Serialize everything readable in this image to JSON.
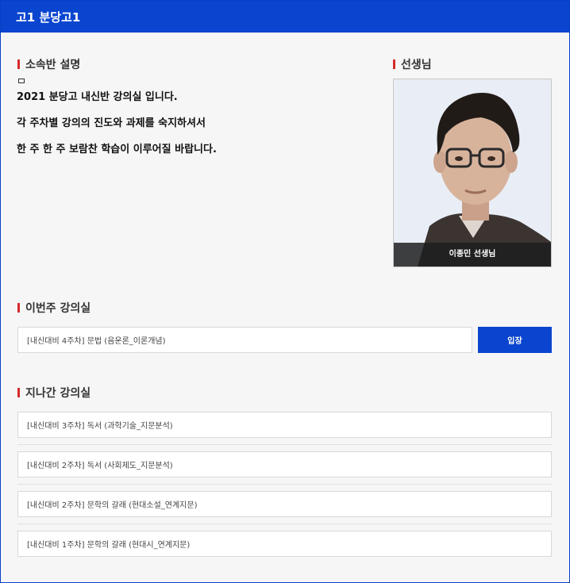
{
  "header": {
    "title": "고1 분당고1"
  },
  "sections": {
    "description_title": "소속반 설명",
    "teacher_title": "선생님",
    "current_title": "이번주 강의실",
    "past_title": "지나간 강의실"
  },
  "description": {
    "lines": [
      "2021 분당고 내신반 강의실 입니다.",
      "각 주차별 강의의 진도와 과제를 숙지하셔서",
      "한 주 한 주 보람찬 학습이 이루어질 바랍니다."
    ]
  },
  "teacher": {
    "caption": "이종민 선생님"
  },
  "current": {
    "lecture": "[내신대비 4주차] 문법 (음운론_이론개념)",
    "enter_label": "입장",
    "accent": "#0a45d0"
  },
  "past": {
    "items": [
      "[내신대비 3주차] 독서 (과학기술_지문분석)",
      "[내신대비 2주차] 독서 (사회제도_지문분석)",
      "[내신대비 2주차] 문학의 갈래 (현대소설_연계지문)",
      "[내신대비 1주차] 문학의 갈래 (현대시_연계지문)"
    ]
  }
}
